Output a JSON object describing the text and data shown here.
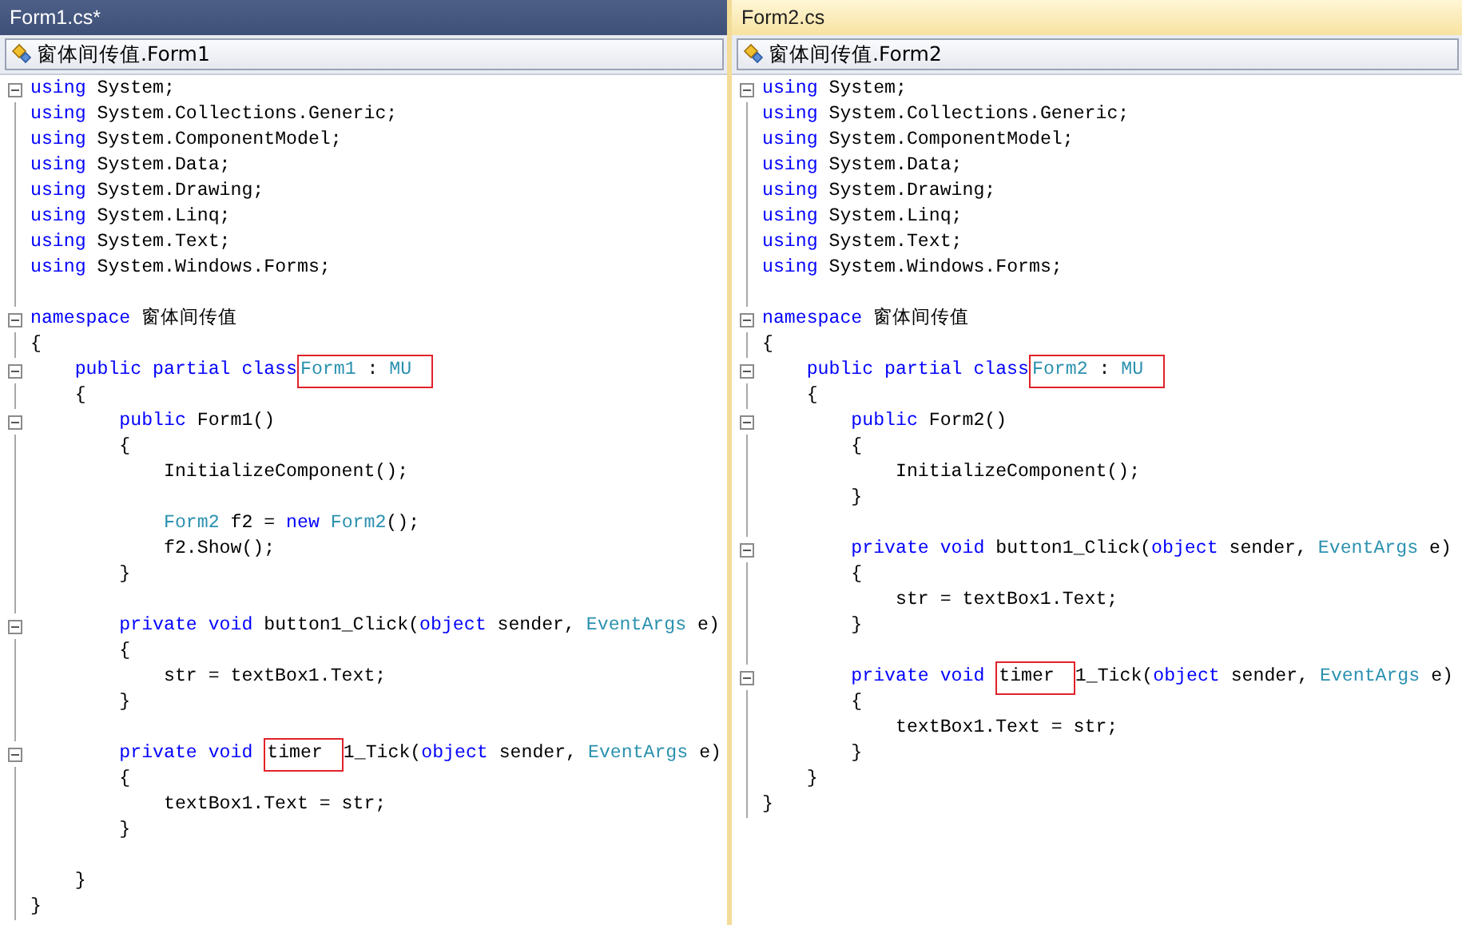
{
  "editors": [
    {
      "tab": {
        "title": "Form1.cs*",
        "active": false
      },
      "navigation": {
        "label": "窗体间传值.Form1"
      },
      "lines": [
        {
          "kind": "fold",
          "tokens": [
            {
              "kind": "keyword",
              "text": "using"
            },
            {
              "kind": "plain",
              "text": " System;"
            }
          ]
        },
        {
          "kind": "code",
          "tokens": [
            {
              "kind": "keyword",
              "text": "using"
            },
            {
              "kind": "plain",
              "text": " System.Collections.Generic;"
            }
          ]
        },
        {
          "kind": "code",
          "tokens": [
            {
              "kind": "keyword",
              "text": "using"
            },
            {
              "kind": "plain",
              "text": " System.ComponentModel;"
            }
          ]
        },
        {
          "kind": "code",
          "tokens": [
            {
              "kind": "keyword",
              "text": "using"
            },
            {
              "kind": "plain",
              "text": " System.Data;"
            }
          ]
        },
        {
          "kind": "code",
          "tokens": [
            {
              "kind": "keyword",
              "text": "using"
            },
            {
              "kind": "plain",
              "text": " System.Drawing;"
            }
          ]
        },
        {
          "kind": "code",
          "tokens": [
            {
              "kind": "keyword",
              "text": "using"
            },
            {
              "kind": "plain",
              "text": " System.Linq;"
            }
          ]
        },
        {
          "kind": "code",
          "tokens": [
            {
              "kind": "keyword",
              "text": "using"
            },
            {
              "kind": "plain",
              "text": " System.Text;"
            }
          ]
        },
        {
          "kind": "code",
          "tokens": [
            {
              "kind": "keyword",
              "text": "using"
            },
            {
              "kind": "plain",
              "text": " System.Windows.Forms;"
            }
          ]
        },
        {
          "kind": "blank"
        },
        {
          "kind": "fold",
          "tokens": [
            {
              "kind": "keyword",
              "text": "namespace"
            },
            {
              "kind": "plain",
              "text": " 窗体间传值"
            }
          ]
        },
        {
          "kind": "code",
          "tokens": [
            {
              "kind": "plain",
              "text": "{"
            }
          ]
        },
        {
          "kind": "fold",
          "tokens": [
            {
              "kind": "keyword",
              "text": "    public partial class"
            },
            {
              "kind": "box",
              "tokens": [
                {
                  "kind": "type",
                  "text": "Form1"
                },
                {
                  "kind": "plain",
                  "text": " : "
                },
                {
                  "kind": "type",
                  "text": "MU"
                }
              ]
            }
          ]
        },
        {
          "kind": "code",
          "tokens": [
            {
              "kind": "plain",
              "text": "    {"
            }
          ]
        },
        {
          "kind": "fold",
          "tokens": [
            {
              "kind": "keyword",
              "text": "        public"
            },
            {
              "kind": "plain",
              "text": " Form1()"
            }
          ]
        },
        {
          "kind": "code",
          "tokens": [
            {
              "kind": "plain",
              "text": "        {"
            }
          ]
        },
        {
          "kind": "code",
          "tokens": [
            {
              "kind": "plain",
              "text": "            InitializeComponent();"
            }
          ]
        },
        {
          "kind": "blank"
        },
        {
          "kind": "code",
          "tokens": [
            {
              "kind": "type",
              "text": "            Form2"
            },
            {
              "kind": "plain",
              "text": " f2 = "
            },
            {
              "kind": "keyword",
              "text": "new"
            },
            {
              "kind": "type",
              "text": " Form2"
            },
            {
              "kind": "plain",
              "text": "();"
            }
          ]
        },
        {
          "kind": "code",
          "tokens": [
            {
              "kind": "plain",
              "text": "            f2.Show();"
            }
          ]
        },
        {
          "kind": "code",
          "tokens": [
            {
              "kind": "plain",
              "text": "        }"
            }
          ]
        },
        {
          "kind": "blank"
        },
        {
          "kind": "fold",
          "tokens": [
            {
              "kind": "keyword",
              "text": "        private void"
            },
            {
              "kind": "plain",
              "text": " button1_Click("
            },
            {
              "kind": "keyword",
              "text": "object"
            },
            {
              "kind": "plain",
              "text": " sender, "
            },
            {
              "kind": "type",
              "text": "EventArgs"
            },
            {
              "kind": "plain",
              "text": " e)"
            }
          ]
        },
        {
          "kind": "code",
          "tokens": [
            {
              "kind": "plain",
              "text": "        {"
            }
          ]
        },
        {
          "kind": "code",
          "tokens": [
            {
              "kind": "plain",
              "text": "            str = textBox1.Text;"
            }
          ]
        },
        {
          "kind": "code",
          "tokens": [
            {
              "kind": "plain",
              "text": "        }"
            }
          ]
        },
        {
          "kind": "blank"
        },
        {
          "kind": "fold",
          "tokens": [
            {
              "kind": "keyword",
              "text": "        private void "
            },
            {
              "kind": "box",
              "tokens": [
                {
                  "kind": "plain",
                  "text": "timer"
                }
              ]
            },
            {
              "kind": "plain",
              "text": "1_Tick("
            },
            {
              "kind": "keyword",
              "text": "object"
            },
            {
              "kind": "plain",
              "text": " sender, "
            },
            {
              "kind": "type",
              "text": "EventArgs"
            },
            {
              "kind": "plain",
              "text": " e)"
            }
          ]
        },
        {
          "kind": "code",
          "tokens": [
            {
              "kind": "plain",
              "text": "        {"
            }
          ]
        },
        {
          "kind": "code",
          "tokens": [
            {
              "kind": "plain",
              "text": "            textBox1.Text = str;"
            }
          ]
        },
        {
          "kind": "code",
          "tokens": [
            {
              "kind": "plain",
              "text": "        }"
            }
          ]
        },
        {
          "kind": "blank"
        },
        {
          "kind": "code",
          "tokens": [
            {
              "kind": "plain",
              "text": "    }"
            }
          ]
        },
        {
          "kind": "code",
          "tokens": [
            {
              "kind": "plain",
              "text": "}"
            }
          ]
        }
      ]
    },
    {
      "tab": {
        "title": "Form2.cs",
        "active": true
      },
      "navigation": {
        "label": "窗体间传值.Form2"
      },
      "lines": [
        {
          "kind": "fold",
          "tokens": [
            {
              "kind": "keyword",
              "text": "using"
            },
            {
              "kind": "plain",
              "text": " System;"
            }
          ]
        },
        {
          "kind": "code",
          "tokens": [
            {
              "kind": "keyword",
              "text": "using"
            },
            {
              "kind": "plain",
              "text": " System.Collections.Generic;"
            }
          ]
        },
        {
          "kind": "code",
          "tokens": [
            {
              "kind": "keyword",
              "text": "using"
            },
            {
              "kind": "plain",
              "text": " System.ComponentModel;"
            }
          ]
        },
        {
          "kind": "code",
          "tokens": [
            {
              "kind": "keyword",
              "text": "using"
            },
            {
              "kind": "plain",
              "text": " System.Data;"
            }
          ]
        },
        {
          "kind": "code",
          "tokens": [
            {
              "kind": "keyword",
              "text": "using"
            },
            {
              "kind": "plain",
              "text": " System.Drawing;"
            }
          ]
        },
        {
          "kind": "code",
          "tokens": [
            {
              "kind": "keyword",
              "text": "using"
            },
            {
              "kind": "plain",
              "text": " System.Linq;"
            }
          ]
        },
        {
          "kind": "code",
          "tokens": [
            {
              "kind": "keyword",
              "text": "using"
            },
            {
              "kind": "plain",
              "text": " System.Text;"
            }
          ]
        },
        {
          "kind": "code",
          "tokens": [
            {
              "kind": "keyword",
              "text": "using"
            },
            {
              "kind": "plain",
              "text": " System.Windows.Forms;"
            }
          ]
        },
        {
          "kind": "blank"
        },
        {
          "kind": "fold",
          "tokens": [
            {
              "kind": "keyword",
              "text": "namespace"
            },
            {
              "kind": "plain",
              "text": " 窗体间传值"
            }
          ]
        },
        {
          "kind": "code",
          "tokens": [
            {
              "kind": "plain",
              "text": "{"
            }
          ]
        },
        {
          "kind": "fold",
          "tokens": [
            {
              "kind": "keyword",
              "text": "    public partial class"
            },
            {
              "kind": "box",
              "tokens": [
                {
                  "kind": "type",
                  "text": "Form2"
                },
                {
                  "kind": "plain",
                  "text": " : "
                },
                {
                  "kind": "type",
                  "text": "MU"
                }
              ]
            }
          ]
        },
        {
          "kind": "code",
          "tokens": [
            {
              "kind": "plain",
              "text": "    {"
            }
          ]
        },
        {
          "kind": "fold",
          "tokens": [
            {
              "kind": "keyword",
              "text": "        public"
            },
            {
              "kind": "plain",
              "text": " Form2()"
            }
          ]
        },
        {
          "kind": "code",
          "tokens": [
            {
              "kind": "plain",
              "text": "        {"
            }
          ]
        },
        {
          "kind": "code",
          "tokens": [
            {
              "kind": "plain",
              "text": "            InitializeComponent();"
            }
          ]
        },
        {
          "kind": "code",
          "tokens": [
            {
              "kind": "plain",
              "text": "        }"
            }
          ]
        },
        {
          "kind": "blank"
        },
        {
          "kind": "fold",
          "tokens": [
            {
              "kind": "keyword",
              "text": "        private void"
            },
            {
              "kind": "plain",
              "text": " button1_Click("
            },
            {
              "kind": "keyword",
              "text": "object"
            },
            {
              "kind": "plain",
              "text": " sender, "
            },
            {
              "kind": "type",
              "text": "EventArgs"
            },
            {
              "kind": "plain",
              "text": " e)"
            }
          ]
        },
        {
          "kind": "code",
          "tokens": [
            {
              "kind": "plain",
              "text": "        {"
            }
          ]
        },
        {
          "kind": "code",
          "tokens": [
            {
              "kind": "plain",
              "text": "            str = textBox1.Text;"
            }
          ]
        },
        {
          "kind": "code",
          "tokens": [
            {
              "kind": "plain",
              "text": "        }"
            }
          ]
        },
        {
          "kind": "blank"
        },
        {
          "kind": "fold",
          "tokens": [
            {
              "kind": "keyword",
              "text": "        private void "
            },
            {
              "kind": "box",
              "tokens": [
                {
                  "kind": "plain",
                  "text": "timer"
                }
              ]
            },
            {
              "kind": "plain",
              "text": "1_Tick("
            },
            {
              "kind": "keyword",
              "text": "object"
            },
            {
              "kind": "plain",
              "text": " sender, "
            },
            {
              "kind": "type",
              "text": "EventArgs"
            },
            {
              "kind": "plain",
              "text": " e)"
            }
          ]
        },
        {
          "kind": "code",
          "tokens": [
            {
              "kind": "plain",
              "text": "        {"
            }
          ]
        },
        {
          "kind": "code",
          "tokens": [
            {
              "kind": "plain",
              "text": "            textBox1.Text = str;"
            }
          ]
        },
        {
          "kind": "code",
          "tokens": [
            {
              "kind": "plain",
              "text": "        }"
            }
          ]
        },
        {
          "kind": "code",
          "tokens": [
            {
              "kind": "plain",
              "text": "    }"
            }
          ]
        },
        {
          "kind": "code",
          "tokens": [
            {
              "kind": "plain",
              "text": "}"
            }
          ]
        }
      ]
    }
  ]
}
